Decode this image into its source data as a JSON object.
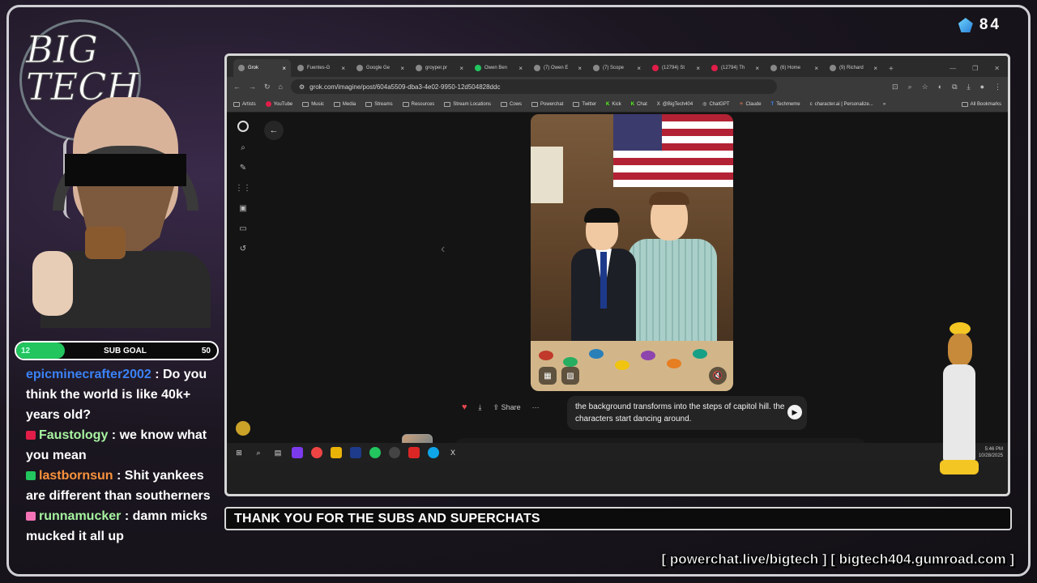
{
  "overlay": {
    "viewer_count": "84",
    "sub_goal": {
      "label": "SUB GOAL",
      "current": "12",
      "target": "50",
      "progress": 0.24
    },
    "logo_text": "BIG TECH",
    "ticker": "THANK YOU FOR THE SUBS AND SUPERCHATS",
    "links": "[ powerchat.live/bigtech ] [ bigtech404.gumroad.com ]"
  },
  "chat": [
    {
      "user": "epicminecrafter2002",
      "text": " : Do you think the world is like 40k+ years old?",
      "user_color": "#3b82f6"
    },
    {
      "user": "Faustology",
      "text": " : we know what you mean",
      "user_color": "#a7f3a0",
      "badge_color": "#e11d48"
    },
    {
      "user": "lastbornsun",
      "text": " : Shit yankees are different than southerners",
      "user_color": "#fb923c",
      "badge_color": "#22c55e"
    },
    {
      "user": "runnamucker",
      "text": " : damn micks mucked it all up",
      "user_color": "#a7f3a0",
      "badge_color": "#f472b6"
    }
  ],
  "browser": {
    "tabs": [
      {
        "label": "Grok",
        "active": true
      },
      {
        "label": "Fuentes-G"
      },
      {
        "label": "Google Ge"
      },
      {
        "label": "groyper.pr"
      },
      {
        "label": "Owen Ben"
      },
      {
        "label": "(7) Owen E"
      },
      {
        "label": "(7) Scope"
      },
      {
        "label": "(12794) St"
      },
      {
        "label": "(12794) Th"
      },
      {
        "label": "(6) Home"
      },
      {
        "label": "(9) Richard"
      }
    ],
    "url": "grok.com/imagine/post/604a5509-dba3-4e02-9950-12d504828ddc",
    "bookmarks": [
      "Artists",
      "YouTube",
      "Music",
      "Media",
      "Streams",
      "Resources",
      "Stream Locations",
      "Cows",
      "Powerchat",
      "Twitter",
      "Kick",
      "Chat",
      "@BigTech404",
      "ChatGPT",
      "Claude",
      "Techmeme",
      "character.ai | Personalize..."
    ],
    "all_bookmarks": "All Bookmarks",
    "share_label": "Share",
    "prompt_text": "the background transforms into the steps of capitol hill. the characters start dancing around.",
    "input_text": "the",
    "clock_time": "5:46 PM",
    "clock_date": "10/28/2025"
  },
  "icons": {
    "back": "←",
    "forward": "→",
    "reload": "↻",
    "home": "⌂",
    "prev": "‹",
    "play": "▶",
    "heart": "♥",
    "more": "···",
    "download": "⤓",
    "share": "⇪"
  }
}
